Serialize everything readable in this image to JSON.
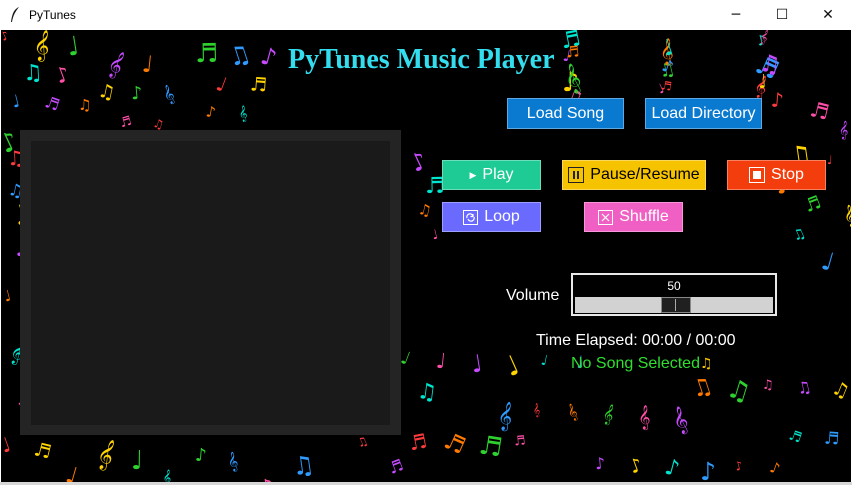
{
  "window": {
    "title": "PyTunes",
    "minimize_glyph": "─",
    "maximize_glyph": "☐",
    "close_glyph": "✕"
  },
  "app": {
    "heading": "PyTunes Music Player",
    "background_color": "#000000",
    "title_color": "#33ddee"
  },
  "buttons": {
    "load_song": "Load Song",
    "load_directory": "Load Directory",
    "play": "Play",
    "pause_resume": "Pause/Resume",
    "stop": "Stop",
    "loop": "Loop",
    "shuffle": "Shuffle"
  },
  "button_icons": {
    "play": "▶",
    "pause": "⏸",
    "stop": "■",
    "loop": "⟲",
    "shuffle": "⤮"
  },
  "volume": {
    "label": "Volume",
    "value": "50",
    "level_percent": 50
  },
  "time_elapsed": "Time Elapsed: 00:00 / 00:00",
  "status": "No Song Selected",
  "colors": {
    "load_buttons": "#0a7ad0",
    "play": "#1ecb94",
    "pause": "#f6c300",
    "stop": "#f33d0c",
    "loop": "#6a6aff",
    "shuffle": "#f060c4",
    "status_text": "#2fdf2f"
  }
}
